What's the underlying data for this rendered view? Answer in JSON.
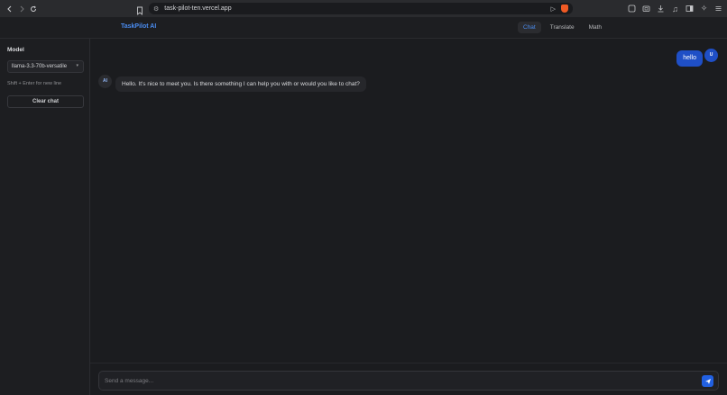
{
  "browser": {
    "url": "task-pilot-ten.vercel.app"
  },
  "header": {
    "title": "TaskPilot AI",
    "tabs": [
      {
        "label": "Chat",
        "active": true
      },
      {
        "label": "Translate",
        "active": false
      },
      {
        "label": "Math",
        "active": false
      }
    ]
  },
  "sidebar": {
    "model_label": "Model",
    "model_value": "llama-3.3-70b-versatile",
    "hint": "Shift + Enter for new line",
    "clear_label": "Clear chat"
  },
  "chat": {
    "messages": [
      {
        "role": "user",
        "avatar": "U",
        "text": "hello"
      },
      {
        "role": "ai",
        "avatar": "AI",
        "text": "Hello. It's nice to meet you. Is there something I can help you with or would you like to chat?"
      }
    ]
  },
  "input": {
    "placeholder": "Send a message..."
  },
  "colors": {
    "accent": "#4a8cf0",
    "user_bubble": "#1f4fc6",
    "background": "#1b1c1f"
  }
}
